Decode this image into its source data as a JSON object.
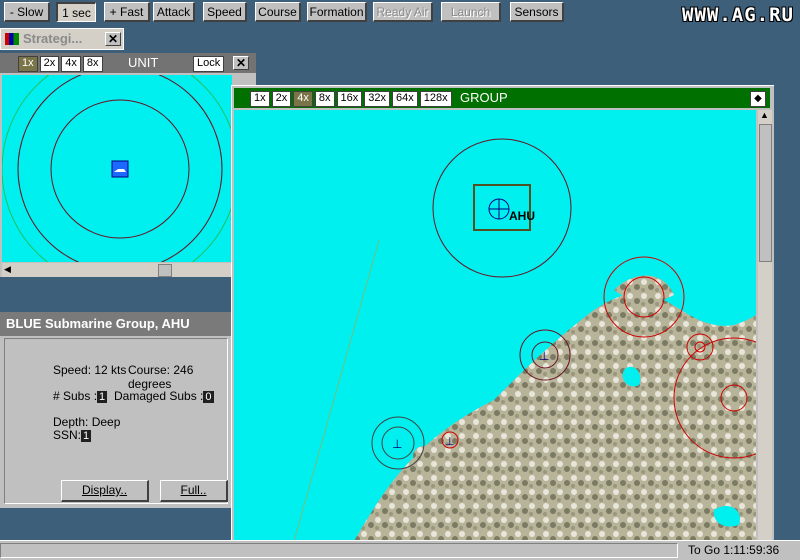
{
  "toolbar": {
    "slow": "- Slow",
    "time": "1 sec",
    "fast": "+ Fast",
    "attack": "Attack",
    "speed": "Speed",
    "course": "Course",
    "formation": "Formation",
    "ready_air": "Ready Air",
    "launch": "Launch",
    "sensors": "Sensors"
  },
  "watermark": "WWW.AG.RU",
  "strategic_window": {
    "title": "Strategi...",
    "close": "✕"
  },
  "unit_window": {
    "zooms": [
      "1x",
      "2x",
      "4x",
      "8x"
    ],
    "selected_zoom": "1x",
    "title": "UNIT",
    "lock": "Lock",
    "close": "✕"
  },
  "group_window": {
    "zooms": [
      "1x",
      "2x",
      "4x",
      "8x",
      "16x",
      "32x",
      "64x",
      "128x"
    ],
    "selected_zoom": "4x",
    "title": "GROUP",
    "unit_label": "AHU"
  },
  "info_panel": {
    "title": "BLUE Submarine Group, AHU",
    "speed": "Speed: 12 kts",
    "course": "Course: 246 degrees",
    "subs_label": "# Subs :",
    "subs_value": "1",
    "damaged_label": "Damaged Subs :",
    "damaged_value": "0",
    "depth": "Depth: Deep",
    "ssn_label": "SSN:",
    "ssn_value": "1",
    "display_btn": "Display..",
    "full_btn": "Full.."
  },
  "status": {
    "to_go": "To Go 1:11:59:36"
  },
  "colors": {
    "sea": "#00f0f0",
    "group_bar": "#007000",
    "hostile": "#d00000",
    "friendly": "#000080"
  }
}
